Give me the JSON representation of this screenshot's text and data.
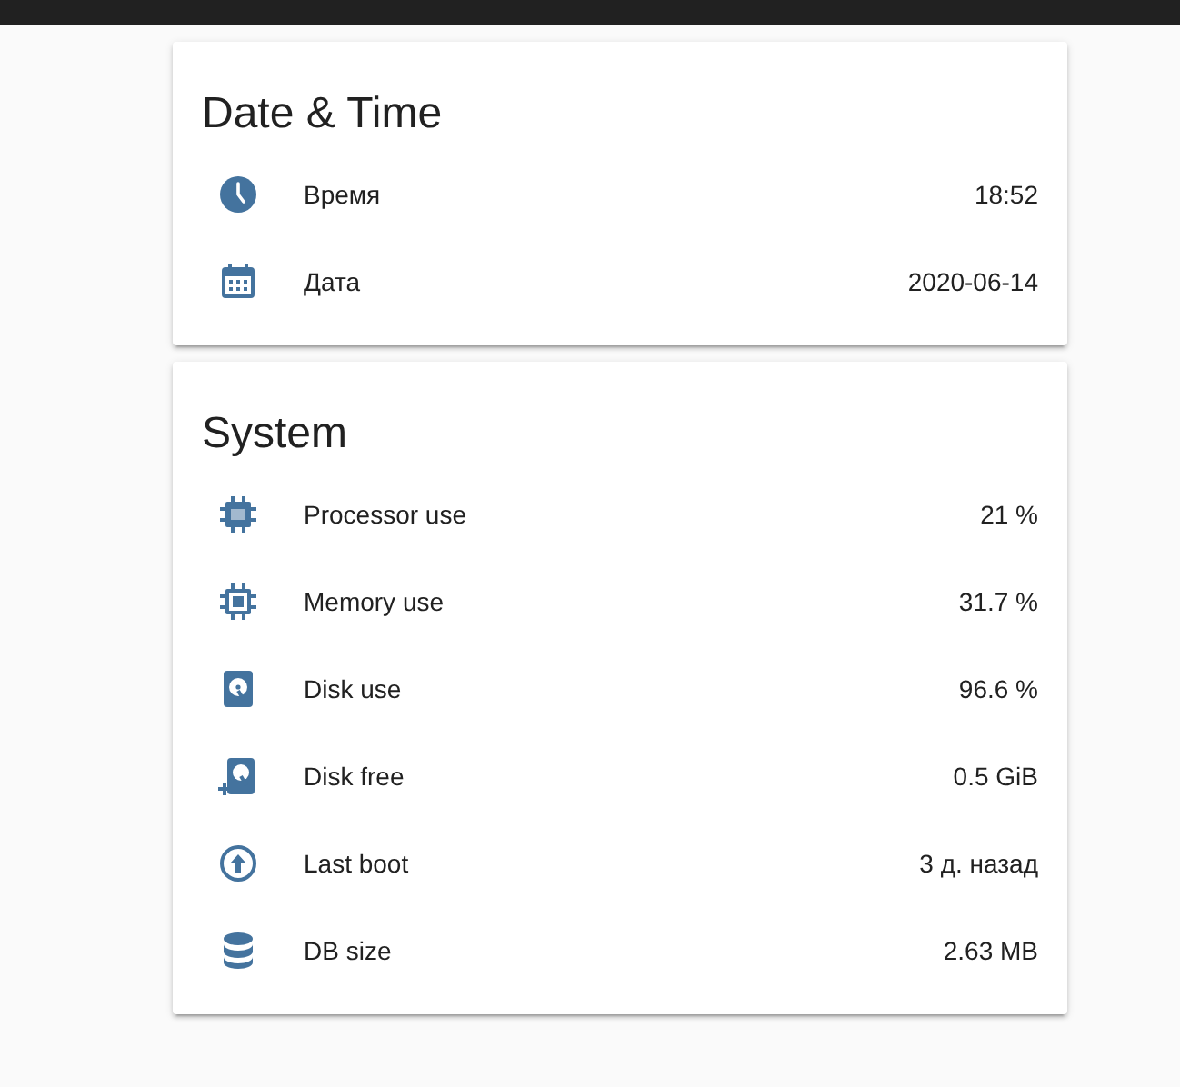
{
  "cards": [
    {
      "title": "Date & Time",
      "rows": [
        {
          "kind": "clock",
          "label": "Время",
          "value": "18:52"
        },
        {
          "kind": "calendar",
          "label": "Дата",
          "value": "2020-06-14"
        }
      ]
    },
    {
      "title": "System",
      "rows": [
        {
          "kind": "cpu64",
          "label": "Processor use",
          "value": "21 %"
        },
        {
          "kind": "chip",
          "label": "Memory use",
          "value": "31.7 %"
        },
        {
          "kind": "disk",
          "label": "Disk use",
          "value": "96.6 %"
        },
        {
          "kind": "diskplus",
          "label": "Disk free",
          "value": "0.5 GiB"
        },
        {
          "kind": "upcircle",
          "label": "Last boot",
          "value": "3 д. назад"
        },
        {
          "kind": "database",
          "label": "DB size",
          "value": "2.63 MB"
        }
      ]
    }
  ]
}
